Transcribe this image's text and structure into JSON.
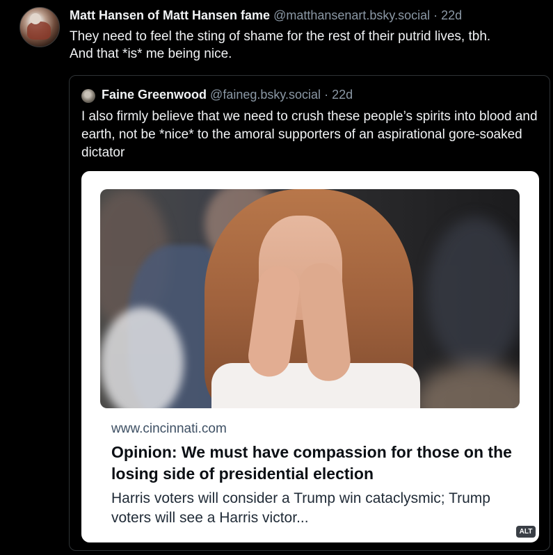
{
  "post": {
    "author": "Matt Hansen of Matt Hansen fame",
    "handle": "@matthansenart.bsky.social",
    "separator": " · ",
    "time": "22d",
    "text_line1": "They need to feel the sting of shame for the rest of their putrid lives, tbh.",
    "text_line2": "And that *is* me being nice."
  },
  "quote": {
    "author": "Faine Greenwood",
    "handle": "@faineg.bsky.social",
    "separator": " · ",
    "time": "22d",
    "text": "I also firmly believe that we need to crush these people’s spirits into blood and earth, not be *nice* to the amoral supporters of an aspirational gore-soaked dictator"
  },
  "link_card": {
    "domain": "www.cincinnati.com",
    "title": "Opinion: We must have compassion for those on the losing side of presidential election",
    "description": "Harris voters will consider a Trump win cataclysmic; Trump voters will see a Harris victor..."
  },
  "alt_badge": "ALT"
}
